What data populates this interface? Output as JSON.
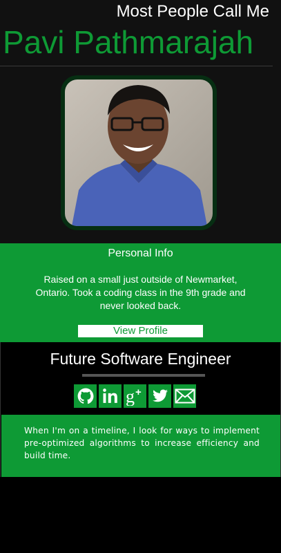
{
  "header": {
    "tagline": "Most People Call Me",
    "name": "Pavi Pathmarajah"
  },
  "profile_photo": {
    "alt": "Profile photo"
  },
  "personal_info": {
    "title": "Personal Info",
    "body": "Raised on a small just outside of Newmarket, Ontario. Took a coding class in the 9th grade and never looked back.",
    "button_label": "View Profile"
  },
  "career": {
    "title": "Future Software Engineer",
    "socials": [
      {
        "icon": "github-icon"
      },
      {
        "icon": "linkedin-icon"
      },
      {
        "icon": "google-plus-icon"
      },
      {
        "icon": "twitter-icon"
      },
      {
        "icon": "mail-icon"
      }
    ],
    "quote": "When I'm on a timeline, I look for ways to implement pre-optimized algorithms to increase efficiency and build time."
  },
  "colors": {
    "accent": "#0e9a35",
    "header_bg": "#111111",
    "page_bg": "#000000"
  }
}
